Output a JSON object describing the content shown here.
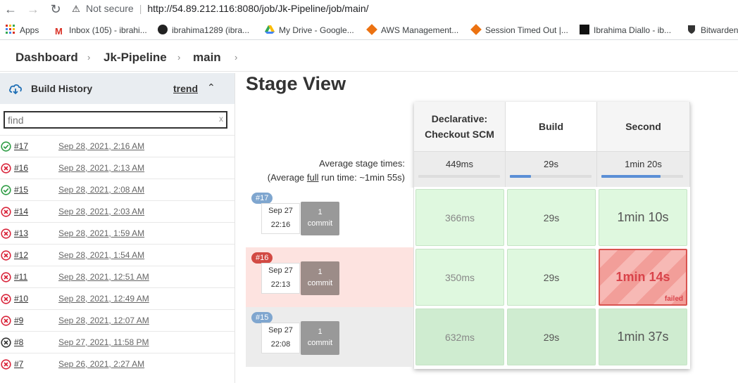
{
  "browser": {
    "not_secure": "Not secure",
    "url": "http://54.89.212.116:8080/job/Jk-Pipeline/job/main/",
    "bookmarks": [
      {
        "label": "Apps",
        "icon": "apps-grid-icon"
      },
      {
        "label": "Inbox (105) - ibrahi...",
        "icon": "gmail-icon"
      },
      {
        "label": "ibrahima1289 (ibra...",
        "icon": "github-icon"
      },
      {
        "label": "My Drive - Google...",
        "icon": "google-drive-icon"
      },
      {
        "label": "AWS Management...",
        "icon": "aws-icon"
      },
      {
        "label": "Session Timed Out |...",
        "icon": "aws-icon"
      },
      {
        "label": "Ibrahima Diallo - ib...",
        "icon": "hashnode-icon"
      },
      {
        "label": "Bitwarden",
        "icon": "bitwarden-shield-icon"
      }
    ]
  },
  "breadcrumb": [
    "Dashboard",
    "Jk-Pipeline",
    "main"
  ],
  "sidebar": {
    "title": "Build History",
    "trend": "trend",
    "find_placeholder": "find",
    "find_clear": "x",
    "builds": [
      {
        "num": "#17",
        "date": "Sep 28, 2021, 2:16 AM",
        "status": "success"
      },
      {
        "num": "#16",
        "date": "Sep 28, 2021, 2:13 AM",
        "status": "failed"
      },
      {
        "num": "#15",
        "date": "Sep 28, 2021, 2:08 AM",
        "status": "success"
      },
      {
        "num": "#14",
        "date": "Sep 28, 2021, 2:03 AM",
        "status": "failed"
      },
      {
        "num": "#13",
        "date": "Sep 28, 2021, 1:59 AM",
        "status": "failed"
      },
      {
        "num": "#12",
        "date": "Sep 28, 2021, 1:54 AM",
        "status": "failed"
      },
      {
        "num": "#11",
        "date": "Sep 28, 2021, 12:51 AM",
        "status": "failed"
      },
      {
        "num": "#10",
        "date": "Sep 28, 2021, 12:49 AM",
        "status": "failed"
      },
      {
        "num": "#9",
        "date": "Sep 28, 2021, 12:07 AM",
        "status": "failed"
      },
      {
        "num": "#8",
        "date": "Sep 27, 2021, 11:58 PM",
        "status": "aborted"
      },
      {
        "num": "#7",
        "date": "Sep 26, 2021, 2:27 AM",
        "status": "failed"
      }
    ]
  },
  "stage_view": {
    "title": "Stage View",
    "avg_label": "Average stage times:",
    "avg_full_prefix": "(Average ",
    "avg_full_link": "full",
    "avg_full_suffix": " run time: ~1min 55s)",
    "stages": [
      {
        "name_line1": "Declarative:",
        "name_line2": "Checkout SCM",
        "avg": "449ms",
        "avg_fraction": 0.0
      },
      {
        "name_line1": "Build",
        "name_line2": "",
        "avg": "29s",
        "avg_fraction": 0.26
      },
      {
        "name_line1": "Second",
        "name_line2": "",
        "avg": "1min 20s",
        "avg_fraction": 0.72
      }
    ],
    "runs": [
      {
        "badge": "#17",
        "date": "Sep 27",
        "time": "22:16",
        "commit_count": "1",
        "commit_label": "commit",
        "cells": [
          "366ms",
          "29s",
          "1min 10s"
        ]
      },
      {
        "badge": "#16",
        "date": "Sep 27",
        "time": "22:13",
        "commit_count": "1",
        "commit_label": "commit",
        "cells": [
          "350ms",
          "29s",
          "1min 14s"
        ],
        "failed_label": "failed"
      },
      {
        "badge": "#15",
        "date": "Sep 27",
        "time": "22:08",
        "commit_count": "1",
        "commit_label": "commit",
        "cells": [
          "632ms",
          "29s",
          "1min 37s"
        ]
      }
    ]
  },
  "colors": {
    "success": "#2e9c44",
    "failed": "#d9243a",
    "aborted": "#333333",
    "accent_bar": "#5b8fd6"
  }
}
